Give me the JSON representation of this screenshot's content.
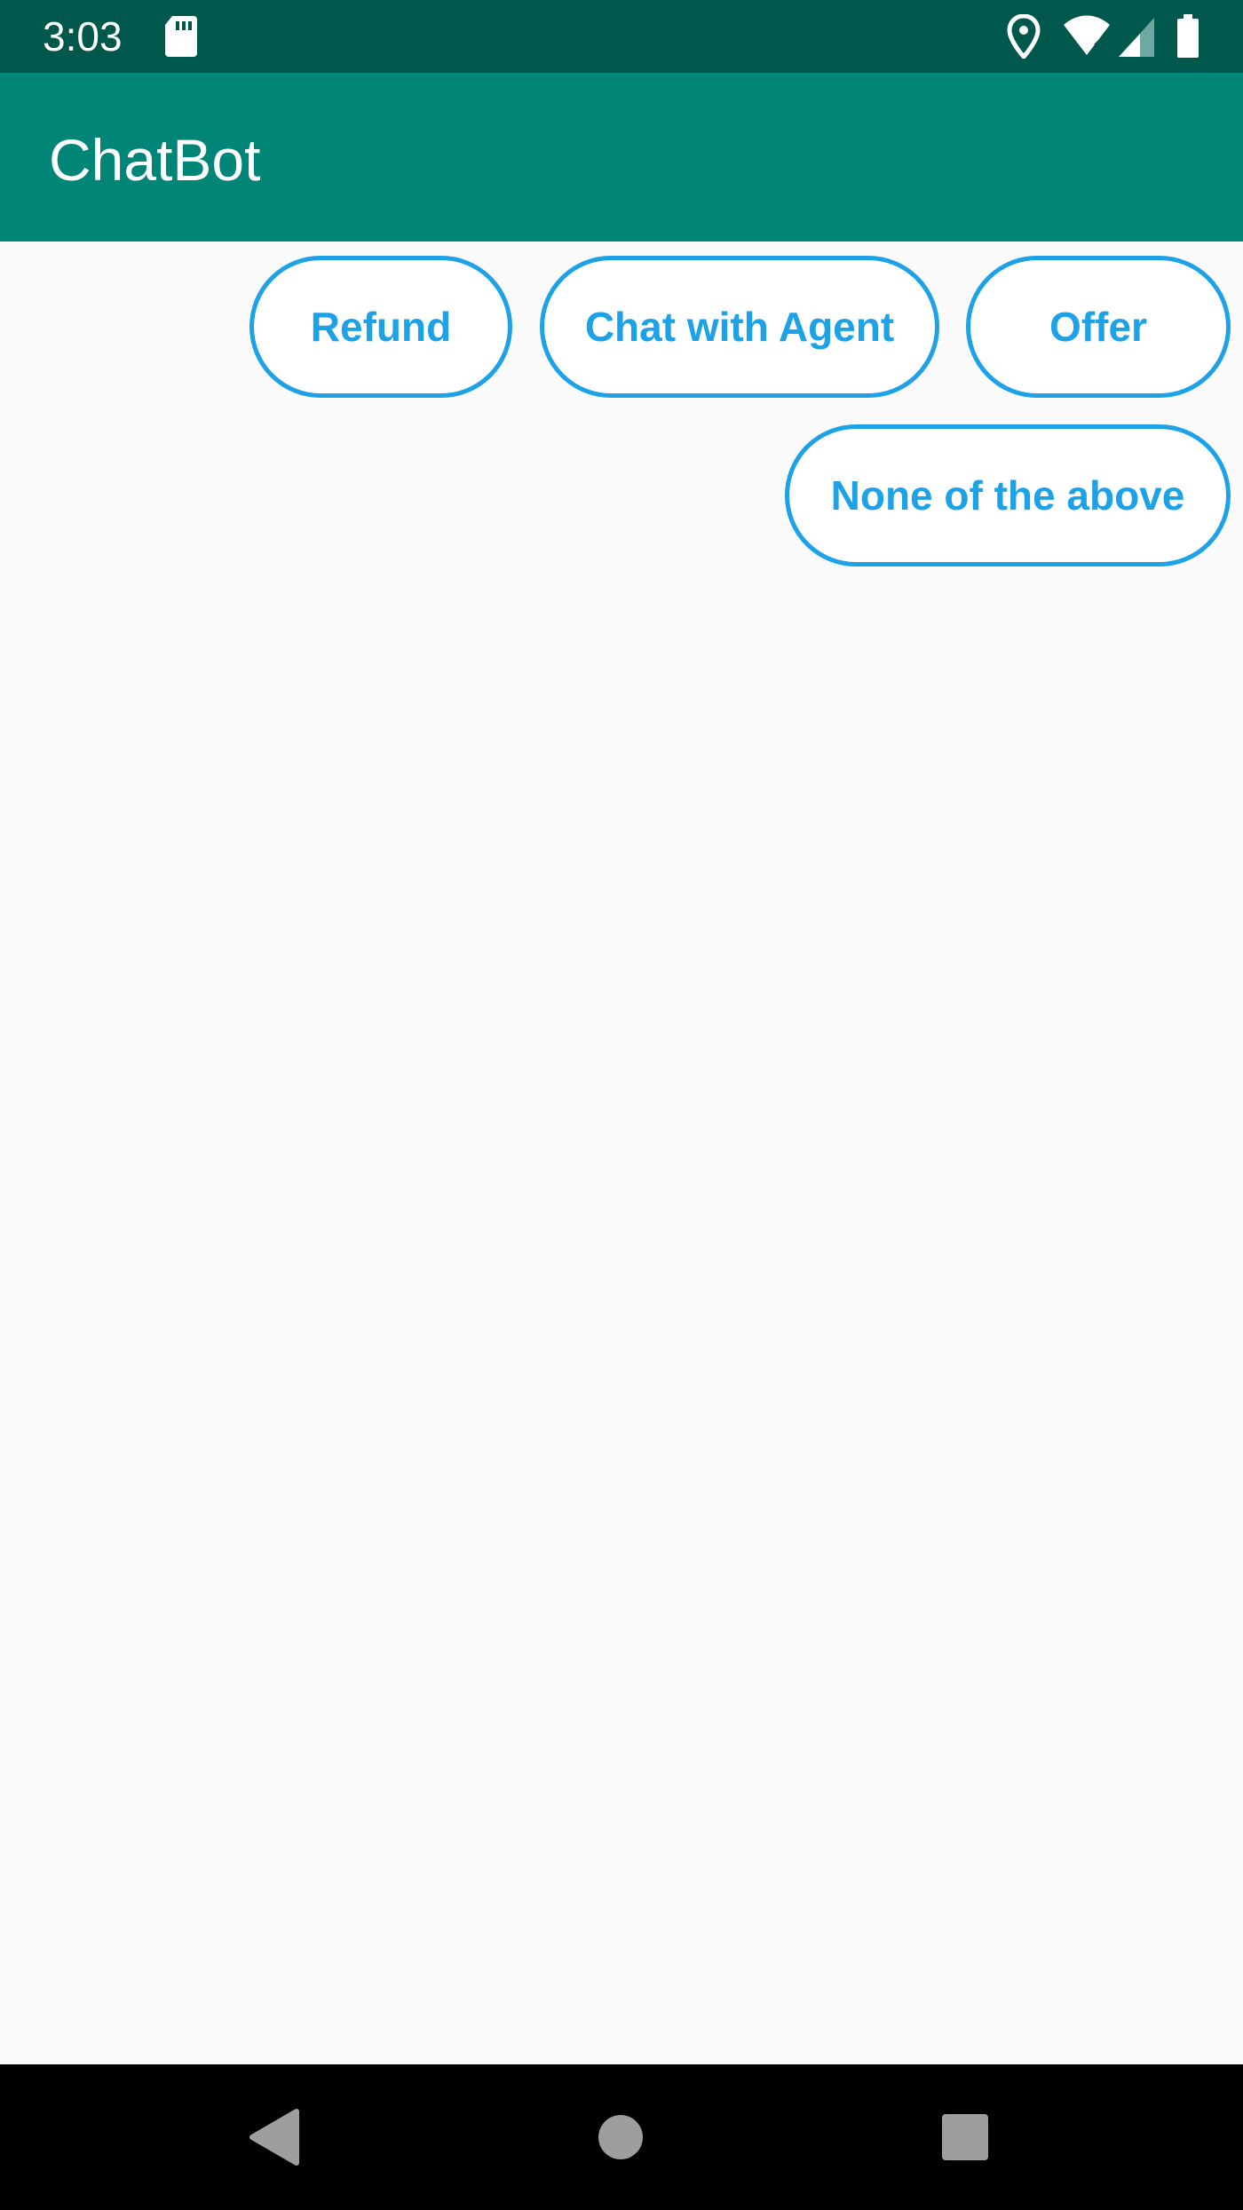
{
  "status_bar": {
    "time": "3:03",
    "icons": [
      "sd-card-icon",
      "location-icon",
      "wifi-off-icon",
      "signal-icon",
      "battery-icon"
    ]
  },
  "app_bar": {
    "title": "ChatBot",
    "color": "#008577"
  },
  "quick_replies": [
    {
      "label": "Refund"
    },
    {
      "label": "Chat with Agent"
    },
    {
      "label": "Offer"
    },
    {
      "label": "None of the above"
    }
  ],
  "accent_color": "#1da1e7",
  "nav_bar": {
    "buttons": [
      "back-icon",
      "home-icon",
      "recents-icon"
    ]
  }
}
